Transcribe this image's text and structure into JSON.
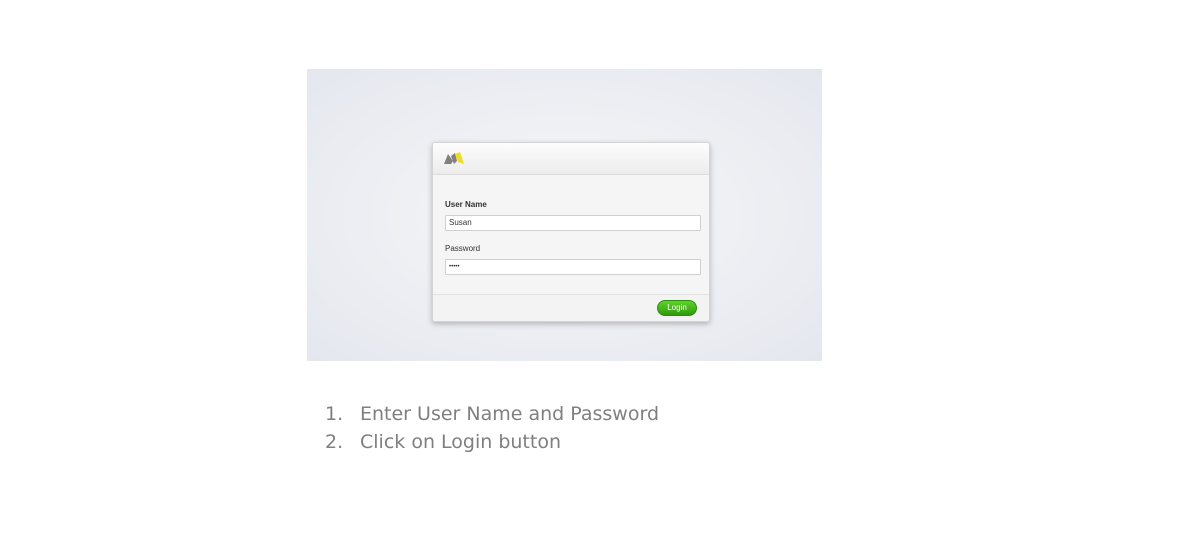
{
  "login_form": {
    "logo_icon": "brand-logo-icon",
    "logo_colors": [
      "#7f7f7f",
      "#f2e01f"
    ],
    "username_label": "User Name",
    "username_value": "Susan",
    "password_label": "Password",
    "password_value": "•••••",
    "login_button_label": "Login",
    "login_button_color": "#3cb614"
  },
  "instructions": {
    "steps": [
      {
        "number": "1.",
        "text": "Enter User Name and Password"
      },
      {
        "number": "2.",
        "text": "Click on Login button"
      }
    ]
  }
}
